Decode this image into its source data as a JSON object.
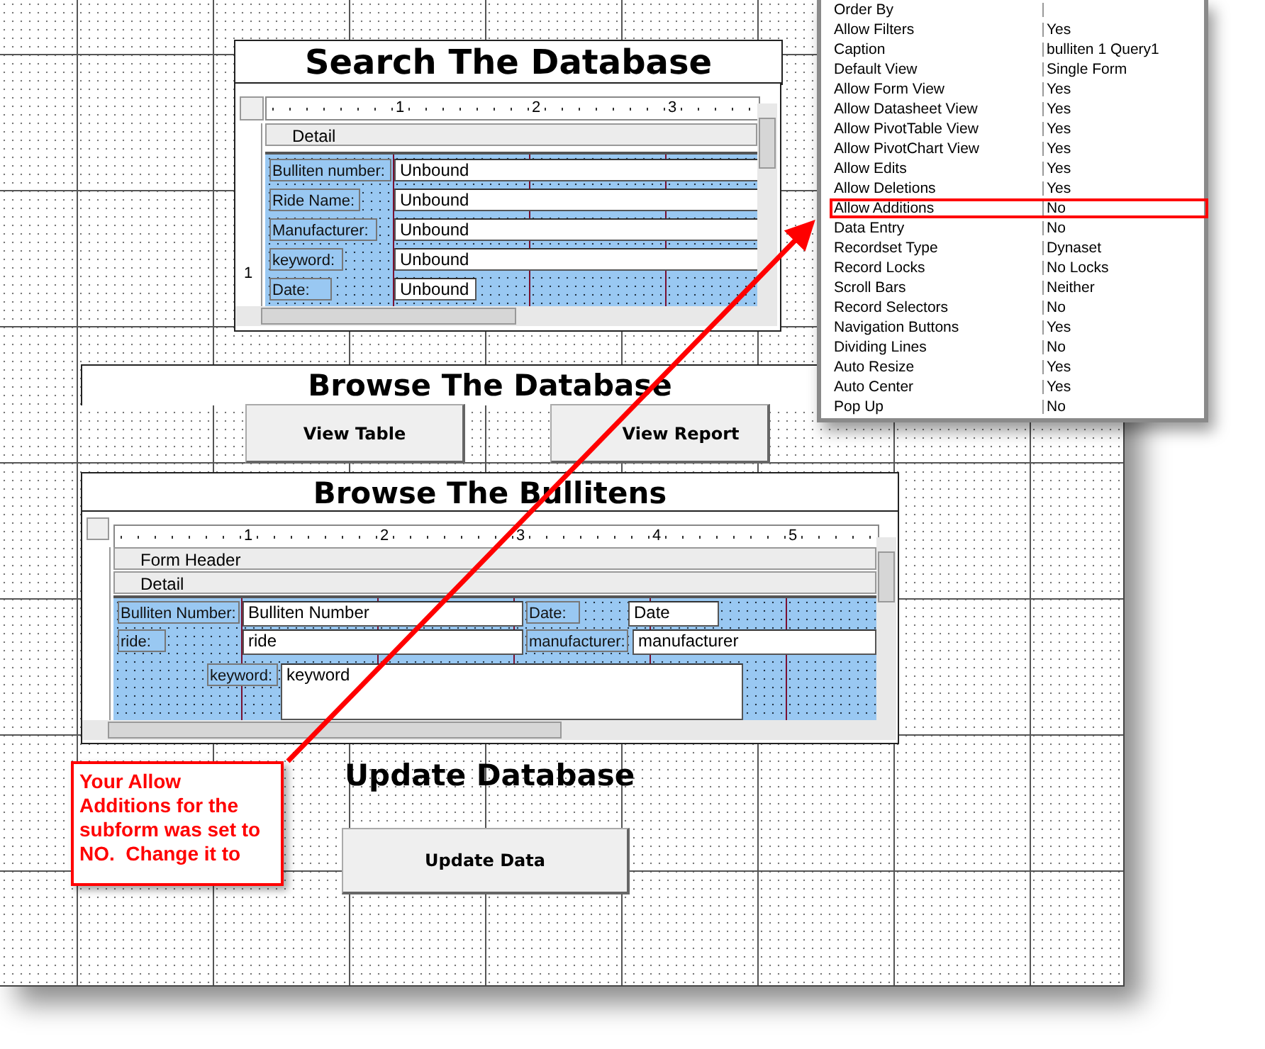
{
  "search_form": {
    "title": "Search The Database",
    "subform": {
      "ruler_marks": [
        "1",
        "2",
        "3"
      ],
      "vertical_ruler_marks": [
        "1"
      ],
      "sections": [
        "Detail"
      ],
      "fields": [
        {
          "label": "Bulliten number:",
          "value": "Unbound"
        },
        {
          "label": "Ride Name:",
          "value": "Unbound"
        },
        {
          "label": "Manufacturer:",
          "value": "Unbound"
        },
        {
          "label": "keyword:",
          "value": "Unbound"
        },
        {
          "label": "Date:",
          "value": "Unbound"
        }
      ]
    }
  },
  "browse_database": {
    "title": "Browse The Database",
    "buttons": [
      "View Table",
      "View Report"
    ]
  },
  "browse_bullitens": {
    "title": "Browse The Bullitens",
    "subform": {
      "ruler_marks": [
        "1",
        "2",
        "3",
        "4",
        "5"
      ],
      "sections": [
        "Form Header",
        "Detail"
      ],
      "fields": [
        {
          "label": "Bulliten Number:",
          "value": "Bulliten Number"
        },
        {
          "label": "Date:",
          "value": "Date"
        },
        {
          "label": "ride:",
          "value": "ride"
        },
        {
          "label": "manufacturer:",
          "value": "manufacturer"
        },
        {
          "label": "keyword:",
          "value": "keyword"
        }
      ]
    }
  },
  "update_section": {
    "title": "Update Database",
    "button": "Update Data"
  },
  "property_sheet": {
    "rows": [
      {
        "name": "Order By",
        "highlighted": false
      },
      {
        "name": "Allow Filters",
        "value": "Yes",
        "highlighted": false
      },
      {
        "name": "Caption",
        "value": "bulliten 1 Query1",
        "highlighted": false
      },
      {
        "name": "Default View",
        "value": "Single Form",
        "highlighted": false
      },
      {
        "name": "Allow Form View",
        "value": "Yes",
        "highlighted": false
      },
      {
        "name": "Allow Datasheet View",
        "value": "Yes",
        "highlighted": false
      },
      {
        "name": "Allow PivotTable View",
        "value": "Yes",
        "highlighted": false
      },
      {
        "name": "Allow PivotChart View",
        "value": "Yes",
        "highlighted": false
      },
      {
        "name": "Allow Edits",
        "value": "Yes",
        "highlighted": false
      },
      {
        "name": "Allow Deletions",
        "value": "Yes",
        "highlighted": false
      },
      {
        "name": "Allow Additions",
        "value": "No",
        "highlighted": true
      },
      {
        "name": "Data Entry",
        "value": "No",
        "highlighted": false
      },
      {
        "name": "Recordset Type",
        "value": "Dynaset",
        "highlighted": false
      },
      {
        "name": "Record Locks",
        "value": "No Locks",
        "highlighted": false
      },
      {
        "name": "Scroll Bars",
        "value": "Neither",
        "highlighted": false
      },
      {
        "name": "Record Selectors",
        "value": "No",
        "highlighted": false
      },
      {
        "name": "Navigation Buttons",
        "value": "Yes",
        "highlighted": false
      },
      {
        "name": "Dividing Lines",
        "value": "No",
        "highlighted": false
      },
      {
        "name": "Auto Resize",
        "value": "Yes",
        "highlighted": false
      },
      {
        "name": "Auto Center",
        "value": "Yes",
        "highlighted": false
      },
      {
        "name": "Pop Up",
        "value": "No",
        "highlighted": false
      }
    ]
  },
  "callout": {
    "text": "Your Allow Additions for the subform was set to NO.  Change it to"
  }
}
